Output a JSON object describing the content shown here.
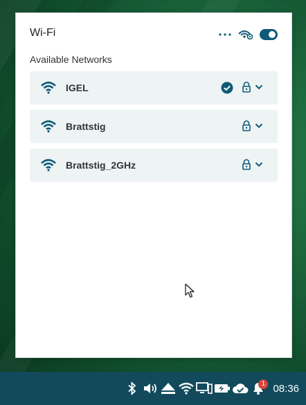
{
  "panel": {
    "title": "Wi-Fi",
    "section_label": "Available Networks",
    "wifi_enabled": true
  },
  "networks": [
    {
      "name": "IGEL",
      "connected": true,
      "secured": true
    },
    {
      "name": "Brattstig",
      "connected": false,
      "secured": true
    },
    {
      "name": "Brattstig_2GHz",
      "connected": false,
      "secured": true
    }
  ],
  "taskbar": {
    "tray_icons": [
      "bluetooth-icon",
      "volume-icon",
      "eject-icon",
      "wifi-icon",
      "display-icon",
      "battery-icon",
      "cloud-check-icon",
      "notification-bell-icon"
    ],
    "notification_count": "1",
    "clock": "08:36"
  },
  "colors": {
    "accent": "#0f5a78",
    "taskbar": "#124a5c",
    "row_bg": "#eef3f4",
    "badge": "#d9443a"
  }
}
